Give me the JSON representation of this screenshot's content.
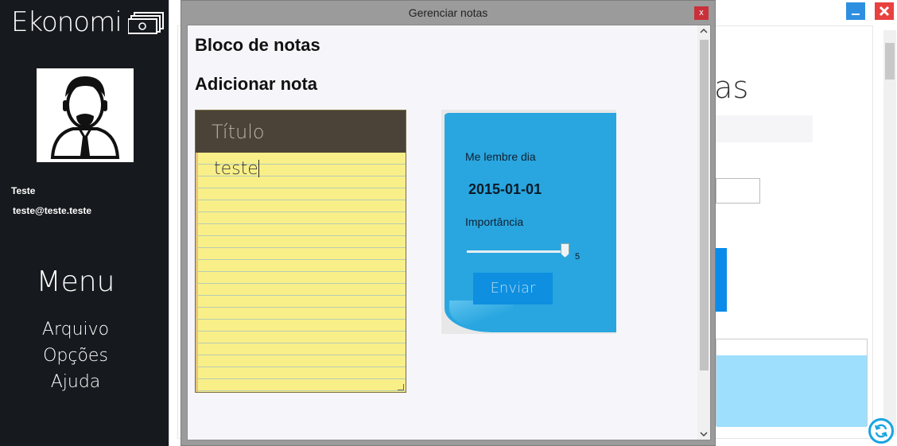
{
  "sidebar": {
    "brand": "Ekonomi",
    "brand_icon": "money-stack-icon",
    "avatar_icon": "user-avatar-icon",
    "user_name": "Teste",
    "user_email": "teste@teste.teste",
    "menu_title": "Menu",
    "menu_items": [
      {
        "label": "Arquivo"
      },
      {
        "label": "Opções"
      },
      {
        "label": "Ajuda"
      }
    ]
  },
  "background_window": {
    "title_fragment": "atas",
    "minimize_icon": "minimize-icon",
    "close_icon": "close-icon",
    "refresh_icon": "refresh-icon"
  },
  "dialog": {
    "title": "Gerenciar notas",
    "close_label": "x",
    "heading_notes": "Bloco de notas",
    "heading_add": "Adicionar nota",
    "note": {
      "title_placeholder": "Título",
      "body_text": "teste"
    },
    "reminder": {
      "remind_label": "Me lembre dia",
      "date_value": "2015-01-01",
      "importance_label": "Importância",
      "importance_value": "5",
      "importance_level": 1.0,
      "send_label": "Enviar"
    }
  },
  "colors": {
    "sidebar_bg": "#16191d",
    "note_title_bg": "#4b4338",
    "note_paper": "#f9ef88",
    "sticky_blue": "#29a6e0",
    "send_button": "#0e8fe0",
    "dialog_close": "#c9303a"
  }
}
